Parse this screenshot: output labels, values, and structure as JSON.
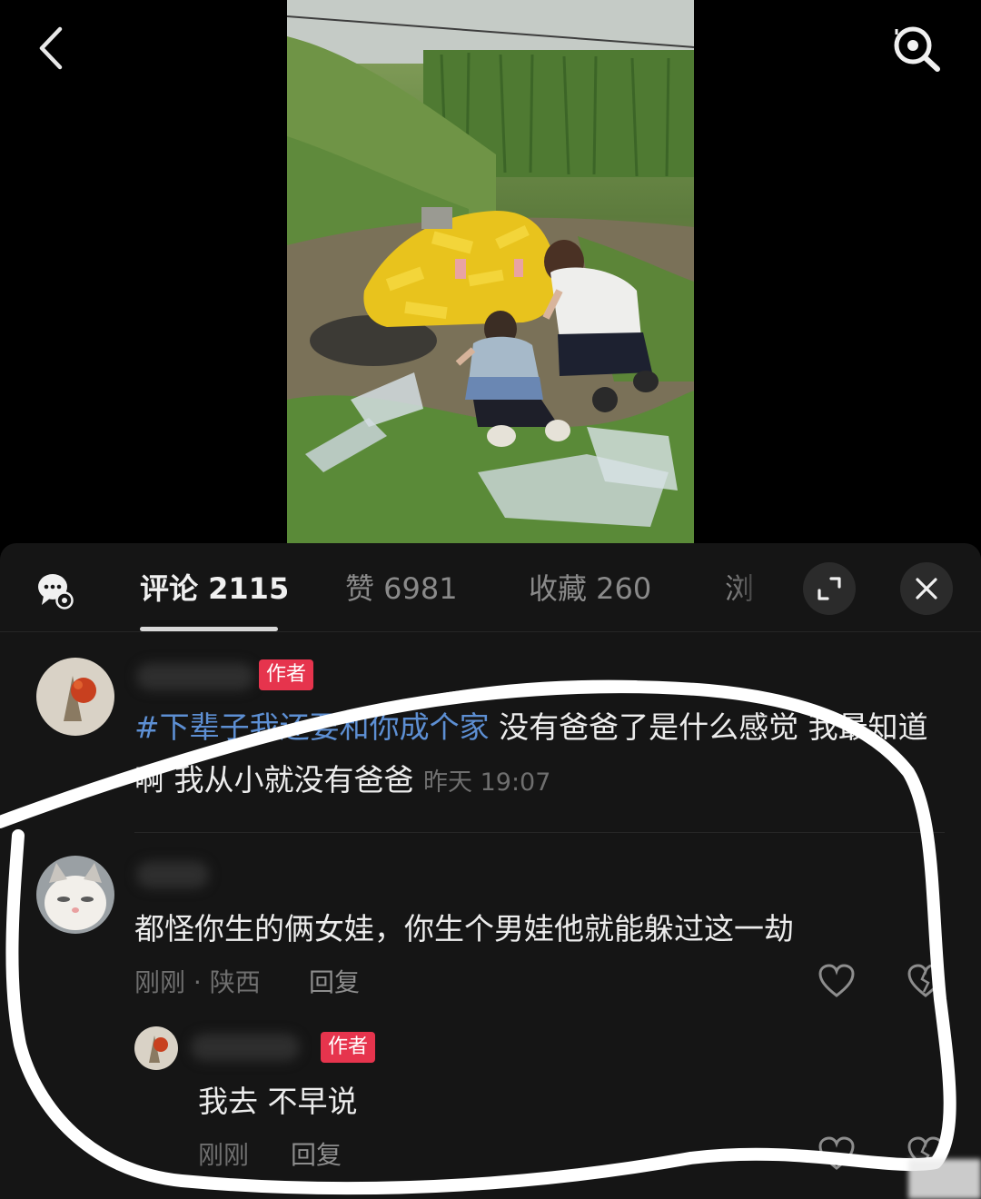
{
  "nav": {
    "back_icon": "chevron-left-icon",
    "search_icon": "search-lens-icon"
  },
  "tabs": [
    {
      "label": "评论 2115",
      "active": true
    },
    {
      "label": "赞 6981",
      "active": false
    },
    {
      "label": "收藏 260",
      "active": false
    },
    {
      "label": "浏",
      "active": false
    }
  ],
  "comments": [
    {
      "badge": "作者",
      "hashtag": "#下辈子我还要和你成个家",
      "text": " 没有爸爸了是什么感觉 我最知道啊 我从小就没有爸爸",
      "time": "昨天 19:07"
    },
    {
      "text": "都怪你生的俩女娃，你生个男娃他就能躲过这一劫",
      "meta": "刚刚 · 陕西",
      "reply_label": "回复",
      "replies": [
        {
          "badge": "作者",
          "text": "我去 不早说",
          "meta": "刚刚",
          "reply_label": "回复"
        }
      ]
    }
  ],
  "colors": {
    "badge": "#e6344d",
    "hashtag": "#5d8fd3",
    "sheet_bg": "#151515"
  }
}
